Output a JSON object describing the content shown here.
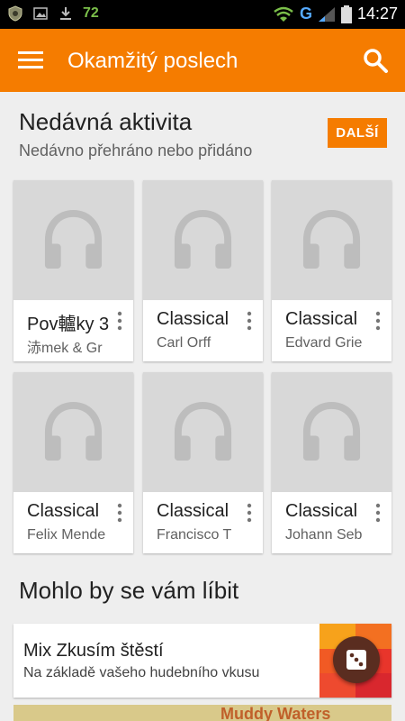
{
  "status_bar": {
    "left_icons": [
      "shield-icon",
      "image-icon",
      "download-icon"
    ],
    "notification_count": "72",
    "network": "G",
    "time": "14:27"
  },
  "app_bar": {
    "title": "Okamžitý poslech",
    "menu_icon": "menu-icon",
    "search_icon": "search-icon",
    "color": "#f57c00"
  },
  "recent": {
    "title": "Nedávná aktivita",
    "subtitle": "Nedávno přehráno nebo přidáno",
    "more_label": "DALŠÍ",
    "items": [
      {
        "title": "Pov轤ky 3",
        "subtitle": "浾mek & Gr"
      },
      {
        "title": "Classical",
        "subtitle": "Carl Orff"
      },
      {
        "title": "Classical",
        "subtitle": "Edvard Grie"
      },
      {
        "title": "Classical",
        "subtitle": "Felix Mende"
      },
      {
        "title": "Classical",
        "subtitle": "Francisco T"
      },
      {
        "title": "Classical",
        "subtitle": "Johann Seb"
      }
    ]
  },
  "suggestions": {
    "title": "Mohlo by se vám líbit",
    "mix": {
      "title": "Mix Zkusím štěstí",
      "subtitle": "Na základě vašeho hudebního vkusu",
      "action_icon": "dice-icon"
    },
    "next_card_text": "Muddy Waters"
  }
}
